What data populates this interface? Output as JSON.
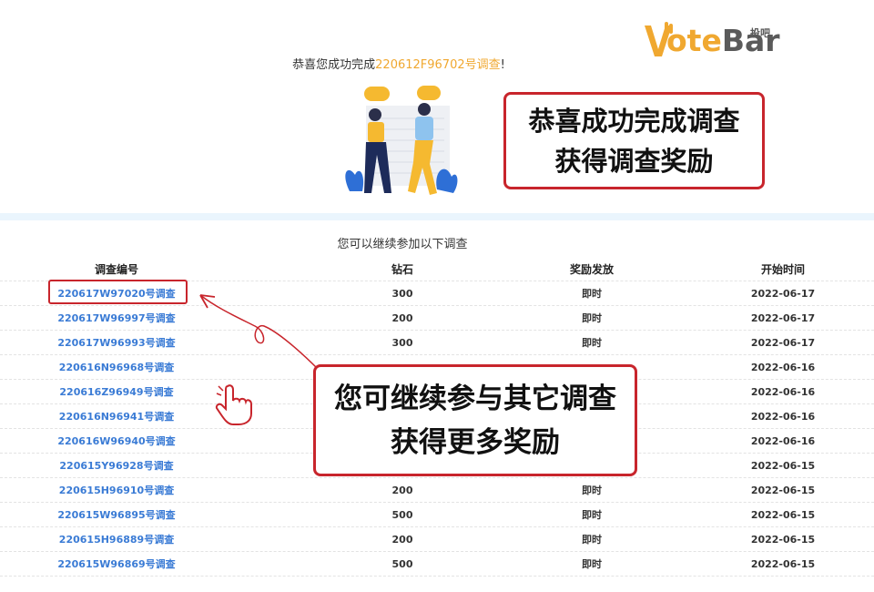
{
  "logo": {
    "text_orange": "ote",
    "text_gray": "Bar",
    "sub": "投吧",
    "letter_v": "V"
  },
  "header": {
    "congrats_prefix": "恭喜您成功完成",
    "survey_id": "220612F96702号调查",
    "congrats_suffix": "!"
  },
  "callout_top": {
    "line1": "恭喜成功完成调查",
    "line2": "获得调查奖励"
  },
  "subtitle": "您可以继续参加以下调查",
  "table": {
    "headers": [
      "调查编号",
      "钻石",
      "奖励发放",
      "开始时间"
    ],
    "rows": [
      [
        "220617W97020号调查",
        "300",
        "即时",
        "2022-06-17"
      ],
      [
        "220617W96997号调查",
        "200",
        "即时",
        "2022-06-17"
      ],
      [
        "220617W96993号调查",
        "300",
        "即时",
        "2022-06-17"
      ],
      [
        "220616N96968号调查",
        "",
        "",
        "2022-06-16"
      ],
      [
        "220616Z96949号调查",
        "",
        "",
        "2022-06-16"
      ],
      [
        "220616N96941号调查",
        "",
        "",
        "2022-06-16"
      ],
      [
        "220616W96940号调查",
        "",
        "",
        "2022-06-16"
      ],
      [
        "220615Y96928号调查",
        "",
        "",
        "2022-06-15"
      ],
      [
        "220615H96910号调查",
        "200",
        "即时",
        "2022-06-15"
      ],
      [
        "220615W96895号调查",
        "500",
        "即时",
        "2022-06-15"
      ],
      [
        "220615H96889号调查",
        "200",
        "即时",
        "2022-06-15"
      ],
      [
        "220615W96869号调查",
        "500",
        "即时",
        "2022-06-15"
      ]
    ]
  },
  "callout_bottom": {
    "line1": "您可继续参与其它调查",
    "line2": "获得更多奖励"
  },
  "colors": {
    "accent_orange": "#f0a830",
    "link_blue": "#3a7bd5",
    "annotation_red": "#c8252c"
  }
}
